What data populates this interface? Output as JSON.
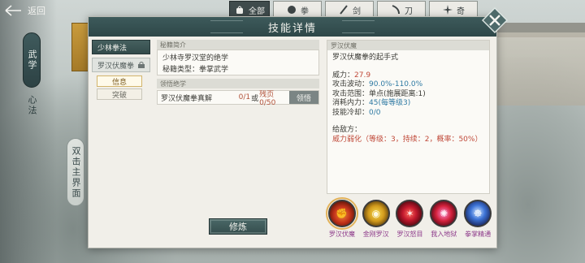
{
  "nav": {
    "back_label": "返回"
  },
  "side": {
    "tab_martial": "武学",
    "tab_heart": "心法",
    "tab_bottom": "双击主界面"
  },
  "categories": [
    {
      "label": "全部",
      "icon": "bag-icon",
      "active": true
    },
    {
      "label": "拳",
      "icon": "fist-icon",
      "active": false
    },
    {
      "label": "剑",
      "icon": "sword-icon",
      "active": false
    },
    {
      "label": "刀",
      "icon": "blade-icon",
      "active": false
    },
    {
      "label": "奇",
      "icon": "shuriken-icon",
      "active": false
    }
  ],
  "modal": {
    "title": "技能详情",
    "left_nav": {
      "skill_1": "少林拳法",
      "skill_2": "罗汉伏魔拳",
      "info_label": "信息",
      "break_label": "突破"
    },
    "intro": {
      "head": "秘籍简介",
      "line1": "少林寺罗汉堂的绝学",
      "line2": "秘籍类型：拳掌武学"
    },
    "requirements": {
      "head": "领悟绝学",
      "item_name": "罗汉伏魔拳真解",
      "count_a": "0/1",
      "sep": "或",
      "count_b": "残页0/50",
      "claim_label": "领悟"
    },
    "train_label": "修炼",
    "detail": {
      "head": "罗汉伏魔",
      "desc": "罗汉伏魔拳的起手式",
      "power_label": "威力：",
      "power_value": "27.9",
      "wave_label": "攻击波动：",
      "wave_value": "90.0%-110.0%",
      "range_label": "攻击范围：",
      "range_value": "单点(施展距离:1)",
      "cost_label": "消耗内力：",
      "cost_value": "45(每等级3)",
      "cd_label": "技能冷却：",
      "cd_value": "0/0",
      "enemy_label": "给敌方：",
      "enemy_effect": "威力弱化（等级：3，持续：2，概率：50%）"
    },
    "skills": [
      {
        "label": "罗汉伏魔",
        "icon": "fire-fist-icon",
        "selected": true
      },
      {
        "label": "金刚罗汉",
        "icon": "golden-shield-icon",
        "selected": false
      },
      {
        "label": "罗汉怒目",
        "icon": "fury-icon",
        "selected": false
      },
      {
        "label": "我入地狱",
        "icon": "hell-burst-icon",
        "selected": false
      },
      {
        "label": "拳掌精通",
        "icon": "mastery-icon",
        "selected": false
      }
    ]
  }
}
